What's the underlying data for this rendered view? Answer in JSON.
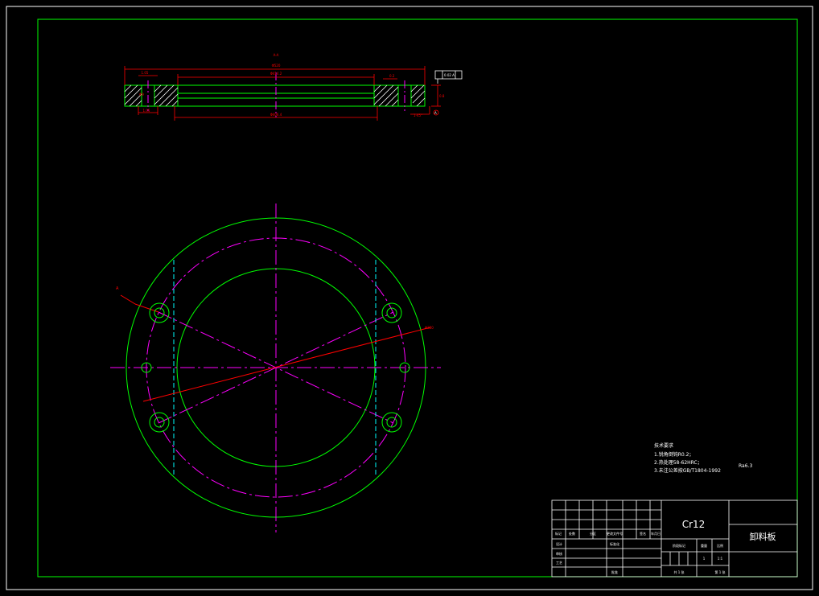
{
  "colors": {
    "background": "#000000",
    "frame_outer": "#ffffff",
    "outline": "#00ff00",
    "centerline": "#ff00ff",
    "dimension": "#ff0000",
    "hidden": "#00ffff",
    "hatch": "#ffffff",
    "text": "#ffffff",
    "titleblock": "#ffffff"
  },
  "section_view": {
    "section_label": "A-A",
    "overall_dim": "Φ520",
    "inner_top_dim": "Φ414.2",
    "inner_bottom_dim": "Φ406.4",
    "slot_dim_top": "1.05",
    "slot_dim_bottom": "1.05",
    "hole_side_dim": "Φ9",
    "thickness_dim": "0.8",
    "chamfer_dim": "0.2",
    "right_dim": "1-45°",
    "tolerance_frame": "0.02 A",
    "datum_label": "A"
  },
  "plan_view": {
    "section_marker_left": "A",
    "section_marker_right": "A",
    "dim_label": "Φ320"
  },
  "notes": {
    "title": "技术要求",
    "items": [
      "1.锐角倒钝R0.2；",
      "2.热处理58-62HRC；",
      "3.未注公差按GB/T1804-1992"
    ],
    "roughness": "Ra6.3"
  },
  "title_block": {
    "material": "Cr12",
    "part_name": "卸料板",
    "header_row": [
      "标记",
      "处数",
      "分区",
      "更改文件号",
      "签名",
      "年月日"
    ],
    "designer_label": "设计",
    "standardization_label": "标准化",
    "checker_label": "审核",
    "process_label": "工艺",
    "approve_label": "批准",
    "stage_label": "阶段标记",
    "weight_label": "重量",
    "scale_label": "比例",
    "weight_value": "1",
    "scale_value": "1:1",
    "sheets_total": "共 1 张",
    "sheet_number": "第 1 张"
  }
}
